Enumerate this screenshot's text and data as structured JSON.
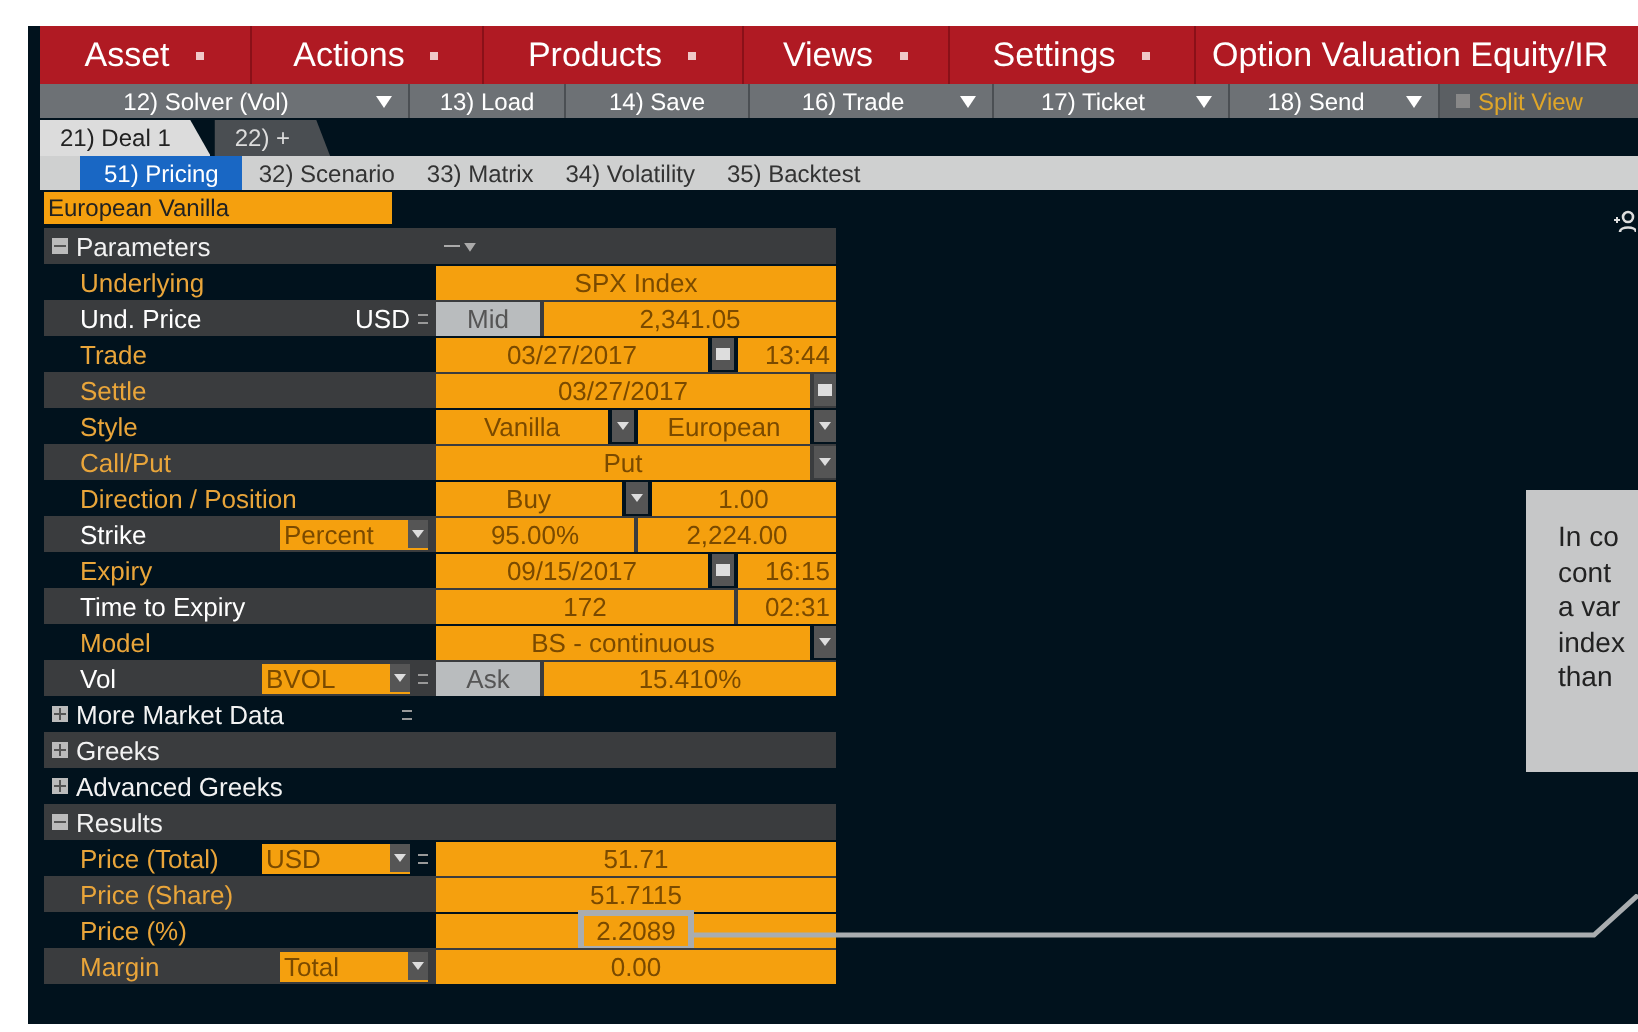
{
  "menu": [
    {
      "label": "Asset",
      "caret": true
    },
    {
      "label": "Actions",
      "caret": true
    },
    {
      "label": "Products",
      "caret": true
    },
    {
      "label": "Views",
      "caret": true
    },
    {
      "label": "Settings",
      "caret": true
    },
    {
      "label": "Option Valuation Equity/IR",
      "caret": false
    }
  ],
  "toolbar": [
    {
      "label": "12) Solver (Vol)",
      "caret": true
    },
    {
      "label": "13) Load",
      "caret": false
    },
    {
      "label": "14) Save",
      "caret": false
    },
    {
      "label": "16) Trade",
      "caret": true
    },
    {
      "label": "17) Ticket",
      "caret": true
    },
    {
      "label": "18) Send",
      "caret": true
    }
  ],
  "split_view": {
    "label": "Split View",
    "checked": false
  },
  "tabs": [
    {
      "label": "21) Deal 1",
      "selected": true
    },
    {
      "label": "22) +",
      "selected": false
    }
  ],
  "subtabs": [
    {
      "label": "51) Pricing",
      "selected": true
    },
    {
      "label": "32) Scenario",
      "selected": false
    },
    {
      "label": "33) Matrix",
      "selected": false
    },
    {
      "label": "34) Volatility",
      "selected": false
    },
    {
      "label": "35) Backtest",
      "selected": false
    }
  ],
  "deal_type": "European Vanilla",
  "rows": [
    {
      "kind": "section",
      "label": "Parameters",
      "expanded": true
    },
    {
      "kind": "field",
      "label": "Underlying",
      "highlighted": true,
      "fields": [
        {
          "kind": "value",
          "text": "SPX Index"
        }
      ]
    },
    {
      "kind": "field",
      "label": "Und. Price",
      "highlighted": false,
      "currency": "USD",
      "linked": true,
      "fields": [
        {
          "kind": "button",
          "text": "Mid"
        },
        {
          "kind": "value",
          "text": "2,341.05"
        }
      ]
    },
    {
      "kind": "field",
      "label": "Trade",
      "highlighted": true,
      "fields": [
        {
          "kind": "date",
          "text": "03/27/2017"
        },
        {
          "kind": "time",
          "text": "13:44"
        }
      ]
    },
    {
      "kind": "field",
      "label": "Settle",
      "highlighted": true,
      "fields": [
        {
          "kind": "date",
          "text": "03/27/2017"
        }
      ]
    },
    {
      "kind": "field",
      "label": "Style",
      "highlighted": true,
      "fields": [
        {
          "kind": "select",
          "text": "Vanilla"
        },
        {
          "kind": "select",
          "text": "European"
        }
      ]
    },
    {
      "kind": "field",
      "label": "Call/Put",
      "highlighted": true,
      "fields": [
        {
          "kind": "select",
          "text": "Put"
        }
      ]
    },
    {
      "kind": "field",
      "label": "Direction / Position",
      "highlighted": true,
      "fields": [
        {
          "kind": "select",
          "text": "Buy"
        },
        {
          "kind": "value",
          "text": "1.00"
        }
      ]
    },
    {
      "kind": "field",
      "label": "Strike",
      "highlighted": false,
      "option": "Percent",
      "fields": [
        {
          "kind": "value",
          "text": "95.00%"
        },
        {
          "kind": "value",
          "text": "2,224.00"
        }
      ]
    },
    {
      "kind": "field",
      "label": "Expiry",
      "highlighted": true,
      "fields": [
        {
          "kind": "date",
          "text": "09/15/2017"
        },
        {
          "kind": "time",
          "text": "16:15"
        }
      ]
    },
    {
      "kind": "field",
      "label": "Time to Expiry",
      "highlighted": false,
      "fields": [
        {
          "kind": "value",
          "text": "172"
        },
        {
          "kind": "time",
          "text": "02:31"
        }
      ]
    },
    {
      "kind": "field",
      "label": "Model",
      "highlighted": true,
      "fields": [
        {
          "kind": "select",
          "text": "BS - continuous"
        }
      ]
    },
    {
      "kind": "field",
      "label": "Vol",
      "highlighted": false,
      "option": "BVOL",
      "linked": true,
      "fields": [
        {
          "kind": "button",
          "text": "Ask"
        },
        {
          "kind": "value",
          "text": "15.410%"
        }
      ]
    },
    {
      "kind": "section",
      "label": "More Market Data",
      "expanded": false,
      "linked": true
    },
    {
      "kind": "section",
      "label": "Greeks",
      "expanded": false
    },
    {
      "kind": "section",
      "label": "Advanced Greeks",
      "expanded": false
    },
    {
      "kind": "section",
      "label": "Results",
      "expanded": true
    },
    {
      "kind": "field",
      "label": "Price (Total)",
      "highlighted": true,
      "option": "USD",
      "linked": true,
      "fields": [
        {
          "kind": "value",
          "text": "51.71"
        }
      ]
    },
    {
      "kind": "field",
      "label": "Price (Share)",
      "highlighted": true,
      "fields": [
        {
          "kind": "value",
          "text": "51.7115"
        }
      ]
    },
    {
      "kind": "field",
      "label": "Price (%)",
      "highlighted": true,
      "fields": [
        {
          "kind": "value",
          "text": "2.2089",
          "callout": true
        }
      ]
    },
    {
      "kind": "field",
      "label": "Margin",
      "highlighted": true,
      "option": "Total",
      "fields": [
        {
          "kind": "value",
          "text": "0.00"
        }
      ]
    }
  ],
  "callout": {
    "text": "In co\ncont\na var\nindex\nthan"
  }
}
